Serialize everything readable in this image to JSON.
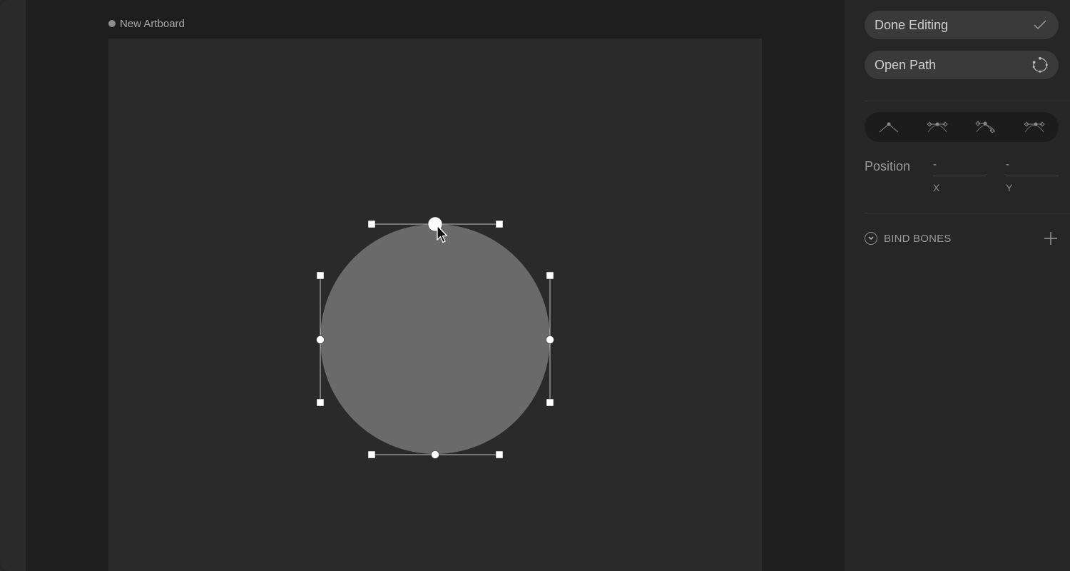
{
  "canvas": {
    "artboard_name": "New Artboard"
  },
  "shape": {
    "type": "ellipse",
    "fill": "#6a6a6a"
  },
  "panel": {
    "done_editing": {
      "label": "Done Editing",
      "icon": "checkmark-icon"
    },
    "open_path": {
      "label": "Open Path",
      "icon": "open-path-icon"
    },
    "vertex_tools": [
      {
        "name": "vertex-straight-tool",
        "icon": "vertex-straight-icon"
      },
      {
        "name": "vertex-mirrored-tool",
        "icon": "vertex-mirrored-icon"
      },
      {
        "name": "vertex-detached-tool",
        "icon": "vertex-detached-icon"
      },
      {
        "name": "vertex-asymmetric-tool",
        "icon": "vertex-asymmetric-icon"
      }
    ],
    "position": {
      "label": "Position",
      "x_value": "-",
      "y_value": "-",
      "x_axis": "X",
      "y_axis": "Y"
    },
    "bind_bones": {
      "label": "BIND BONES",
      "add_icon": "plus-icon",
      "toggle_icon": "chevron-down-icon"
    }
  },
  "colors": {
    "stage_bg": "#1e1e1e",
    "artboard_bg": "#2a2a2a",
    "panel_bg": "#262626",
    "button_bg": "#3a3a3a",
    "handle": "#ffffff"
  }
}
